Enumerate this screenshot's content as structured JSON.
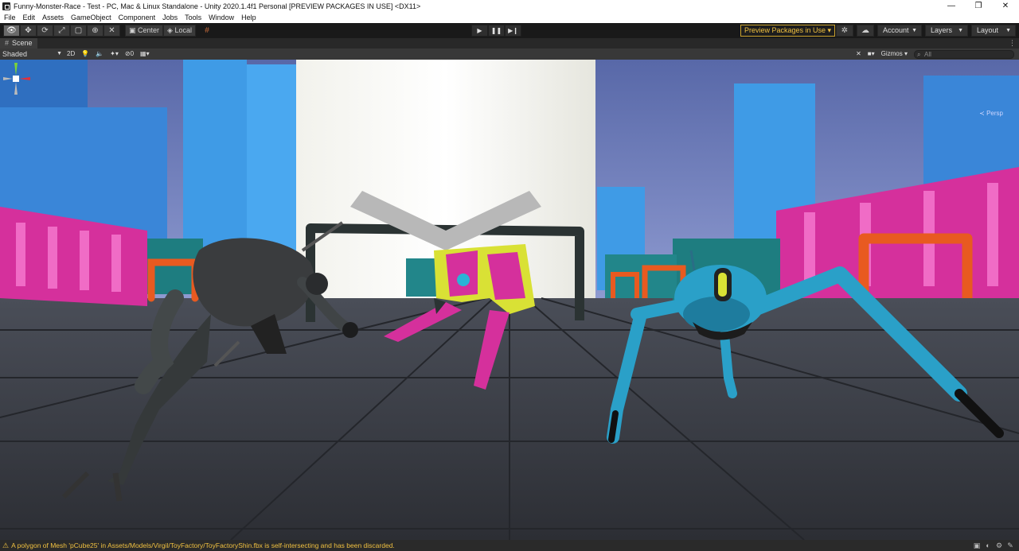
{
  "window": {
    "title": "Funny-Monster-Race - Test - PC, Mac & Linux Standalone - Unity 2020.1.4f1 Personal [PREVIEW PACKAGES IN USE] <DX11>",
    "minimize": "—",
    "restore": "❐",
    "close": "✕"
  },
  "menu": [
    "File",
    "Edit",
    "Assets",
    "GameObject",
    "Component",
    "Jobs",
    "Tools",
    "Window",
    "Help"
  ],
  "toolbar": {
    "tools": [
      {
        "name": "view-tool",
        "glyph": "👁",
        "active": true
      },
      {
        "name": "move-tool",
        "glyph": "✥",
        "active": false
      },
      {
        "name": "rotate-tool",
        "glyph": "⟳",
        "active": false
      },
      {
        "name": "scale-tool",
        "glyph": "⤢",
        "active": false
      },
      {
        "name": "rect-tool",
        "glyph": "▢",
        "active": false
      },
      {
        "name": "transform-tool",
        "glyph": "⊕",
        "active": false
      },
      {
        "name": "custom-tool",
        "glyph": "✕",
        "active": false
      }
    ],
    "pivot_center": "Center",
    "pivot_local": "Local",
    "play": "▶",
    "pause": "❚❚",
    "step": "▶❙",
    "preview_packages": "Preview Packages in Use",
    "account": "Account",
    "layers": "Layers",
    "layout": "Layout"
  },
  "scene": {
    "tab_label": "Scene",
    "draw_mode": "Shaded",
    "mode_2d": "2D",
    "hidden_count": "0",
    "gizmos": "Gizmos",
    "search_placeholder": "All",
    "persp": "Persp"
  },
  "status": {
    "message": "A polygon of Mesh 'pCube25' in Assets/Models/Virgil/ToyFactory/ToyFactoryShin.fbx is self-intersecting and has been discarded."
  },
  "colors": {
    "sky": "#5e6ca8",
    "floor": "#3a3d44",
    "tower_blue": "#3f9be6",
    "wall_pink": "#d5309c",
    "monster_teal": "#2aa0c8",
    "monster_yellow": "#d9e135",
    "warning": "#f0c040"
  }
}
